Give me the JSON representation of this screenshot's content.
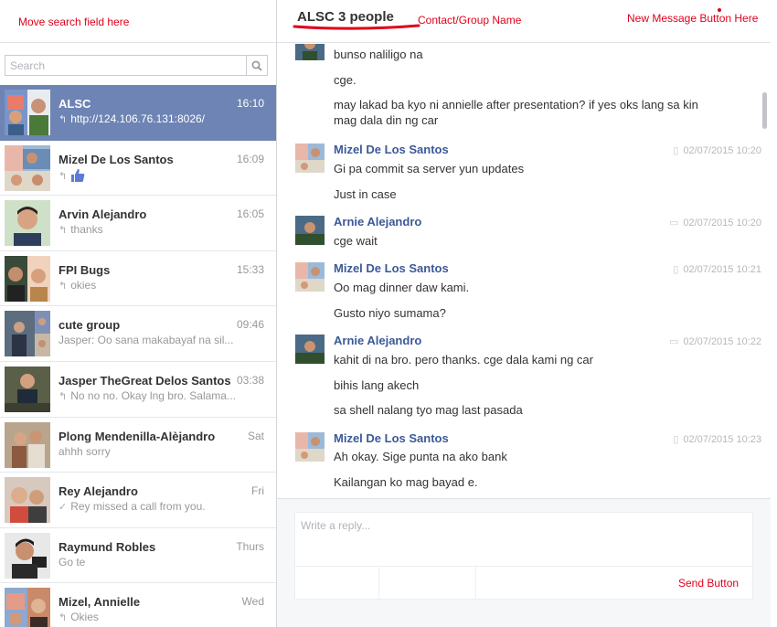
{
  "annotations": {
    "move_search": "Move search field here",
    "contact_group": "Contact/Group Name",
    "new_message": "New Message Button Here",
    "send_button": "Send Button"
  },
  "colors": {
    "annotation": "#e0001a",
    "active_row": "#6d84b4",
    "author_link": "#3b5998"
  },
  "search": {
    "placeholder": "Search",
    "icon": "search-icon"
  },
  "conversations": [
    {
      "name": "ALSC",
      "time": "16:10",
      "preview": "http://124.106.76.131:8026/",
      "reply": true,
      "active": true
    },
    {
      "name": "Mizel De Los Santos",
      "time": "16:09",
      "preview": "",
      "reply": true,
      "like": true
    },
    {
      "name": "Arvin Alejandro",
      "time": "16:05",
      "preview": "thanks",
      "reply": true
    },
    {
      "name": "FPI Bugs",
      "time": "15:33",
      "preview": "okies",
      "reply": true
    },
    {
      "name": "cute group",
      "time": "09:46",
      "preview": "Jasper: Oo sana makabayaf na sil...",
      "reply": false
    },
    {
      "name": "Jasper TheGreat Delos Santos",
      "time": "03:38",
      "preview": "No no no. Okay lng bro. Salama...",
      "reply": true
    },
    {
      "name": "Plong Mendenilla-Alèjandro",
      "time": "Sat",
      "preview": "ahhh sorry",
      "reply": false
    },
    {
      "name": "Rey Alejandro",
      "time": "Fri",
      "preview": "Rey missed a call from you.",
      "check": true
    },
    {
      "name": "Raymund Robles",
      "time": "Thurs",
      "preview": "Go te",
      "reply": false
    },
    {
      "name": "Mizel, Annielle",
      "time": "Wed",
      "preview": "Okies",
      "reply": true
    }
  ],
  "header": {
    "title": "ALSC 3 people"
  },
  "messages": [
    {
      "author": "",
      "time": "",
      "lines": [
        "bunso naliligo na",
        "cge.",
        "may lakad ba kyo ni annielle after presentation? if yes oks lang sa kin mag dala din ng car"
      ]
    },
    {
      "author": "Mizel De Los Santos",
      "time": "02/07/2015 10:20",
      "device": "mobile",
      "lines": [
        "Gi pa commit sa server yun updates",
        "Just in case"
      ]
    },
    {
      "author": "Arnie Alejandro",
      "time": "02/07/2015 10:20",
      "device": "chat",
      "lines": [
        "cge wait"
      ]
    },
    {
      "author": "Mizel De Los Santos",
      "time": "02/07/2015 10:21",
      "device": "mobile",
      "lines": [
        "Oo mag dinner daw kami.",
        "Gusto niyo sumama?"
      ]
    },
    {
      "author": "Arnie Alejandro",
      "time": "02/07/2015 10:22",
      "device": "chat",
      "lines": [
        "kahit di na bro. pero thanks. cge dala kami ng car",
        "bihis lang akech",
        "sa shell nalang tyo mag last pasada"
      ]
    },
    {
      "author": "Mizel De Los Santos",
      "time": "02/07/2015 10:23",
      "device": "mobile",
      "lines": [
        "Ah okay. Sige punta na ako bank",
        "Kailangan ko mag bayad e."
      ]
    }
  ],
  "composer": {
    "placeholder": "Write a reply..."
  }
}
